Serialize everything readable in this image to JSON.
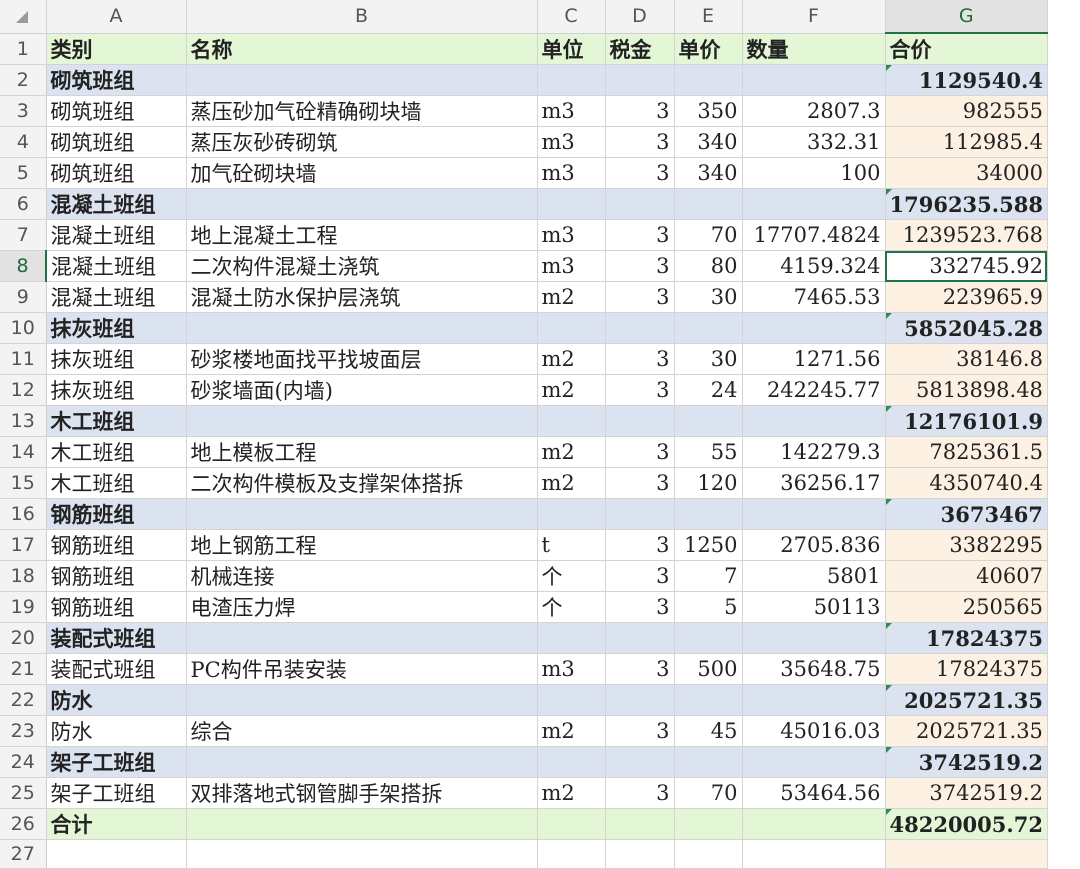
{
  "columns": [
    "A",
    "B",
    "C",
    "D",
    "E",
    "F",
    "G"
  ],
  "selected_column": "G",
  "selected_row": "8",
  "rows": [
    {
      "n": "1",
      "type": "header",
      "cells": [
        "类别",
        "名称",
        "单位",
        "税金",
        "单价",
        "数量",
        "合价"
      ]
    },
    {
      "n": "2",
      "type": "group",
      "cells": [
        "砌筑班组",
        "",
        "",
        "",
        "",
        "",
        "1129540.4"
      ]
    },
    {
      "n": "3",
      "type": "detail",
      "cells": [
        "砌筑班组",
        "蒸压砂加气砼精确砌块墙",
        "m3",
        "3",
        "350",
        "2807.3",
        "982555"
      ]
    },
    {
      "n": "4",
      "type": "detail",
      "cells": [
        "砌筑班组",
        "蒸压灰砂砖砌筑",
        "m3",
        "3",
        "340",
        "332.31",
        "112985.4"
      ]
    },
    {
      "n": "5",
      "type": "detail",
      "cells": [
        "砌筑班组",
        "加气砼砌块墙",
        "m3",
        "3",
        "340",
        "100",
        "34000"
      ]
    },
    {
      "n": "6",
      "type": "group",
      "cells": [
        "混凝土班组",
        "",
        "",
        "",
        "",
        "",
        "1796235.588"
      ]
    },
    {
      "n": "7",
      "type": "detail",
      "cells": [
        "混凝土班组",
        "地上混凝土工程",
        "m3",
        "3",
        "70",
        "17707.4824",
        "1239523.768"
      ]
    },
    {
      "n": "8",
      "type": "selected",
      "cells": [
        "混凝土班组",
        "二次构件混凝土浇筑",
        "m3",
        "3",
        "80",
        "4159.324",
        "332745.92"
      ]
    },
    {
      "n": "9",
      "type": "detail",
      "cells": [
        "混凝土班组",
        "混凝土防水保护层浇筑",
        "m2",
        "3",
        "30",
        "7465.53",
        "223965.9"
      ]
    },
    {
      "n": "10",
      "type": "group",
      "cells": [
        "抹灰班组",
        "",
        "",
        "",
        "",
        "",
        "5852045.28"
      ]
    },
    {
      "n": "11",
      "type": "detail",
      "cells": [
        "抹灰班组",
        "砂浆楼地面找平找坡面层",
        "m2",
        "3",
        "30",
        "1271.56",
        "38146.8"
      ]
    },
    {
      "n": "12",
      "type": "detail",
      "cells": [
        "抹灰班组",
        "砂浆墙面(内墙)",
        "m2",
        "3",
        "24",
        "242245.77",
        "5813898.48"
      ]
    },
    {
      "n": "13",
      "type": "group",
      "cells": [
        "木工班组",
        "",
        "",
        "",
        "",
        "",
        "12176101.9"
      ]
    },
    {
      "n": "14",
      "type": "detail",
      "cells": [
        "木工班组",
        "地上模板工程",
        "m2",
        "3",
        "55",
        "142279.3",
        "7825361.5"
      ]
    },
    {
      "n": "15",
      "type": "detail",
      "cells": [
        "木工班组",
        "二次构件模板及支撑架体搭拆",
        "m2",
        "3",
        "120",
        "36256.17",
        "4350740.4"
      ]
    },
    {
      "n": "16",
      "type": "group",
      "cells": [
        "钢筋班组",
        "",
        "",
        "",
        "",
        "",
        "3673467"
      ]
    },
    {
      "n": "17",
      "type": "detail",
      "cells": [
        "钢筋班组",
        "地上钢筋工程",
        "t",
        "3",
        "1250",
        "2705.836",
        "3382295"
      ]
    },
    {
      "n": "18",
      "type": "detail",
      "cells": [
        "钢筋班组",
        "机械连接",
        "个",
        "3",
        "7",
        "5801",
        "40607"
      ]
    },
    {
      "n": "19",
      "type": "detail",
      "cells": [
        "钢筋班组",
        "电渣压力焊",
        "个",
        "3",
        "5",
        "50113",
        "250565"
      ]
    },
    {
      "n": "20",
      "type": "group",
      "cells": [
        "装配式班组",
        "",
        "",
        "",
        "",
        "",
        "17824375"
      ]
    },
    {
      "n": "21",
      "type": "detail",
      "cells": [
        "装配式班组",
        "PC构件吊装安装",
        "m3",
        "3",
        "500",
        "35648.75",
        "17824375"
      ]
    },
    {
      "n": "22",
      "type": "group",
      "cells": [
        "防水",
        "",
        "",
        "",
        "",
        "",
        "2025721.35"
      ]
    },
    {
      "n": "23",
      "type": "detail",
      "cells": [
        "防水",
        "综合",
        "m2",
        "3",
        "45",
        "45016.03",
        "2025721.35"
      ]
    },
    {
      "n": "24",
      "type": "group",
      "cells": [
        "架子工班组",
        "",
        "",
        "",
        "",
        "",
        "3742519.2"
      ]
    },
    {
      "n": "25",
      "type": "detail",
      "cells": [
        "架子工班组",
        "双排落地式钢管脚手架搭拆",
        "m2",
        "3",
        "70",
        "53464.56",
        "3742519.2"
      ]
    },
    {
      "n": "26",
      "type": "total",
      "cells": [
        "合计",
        "",
        "",
        "",
        "",
        "",
        "48220005.72"
      ]
    },
    {
      "n": "27",
      "type": "empty",
      "cells": [
        "",
        "",
        "",
        "",
        "",
        "",
        ""
      ]
    }
  ]
}
